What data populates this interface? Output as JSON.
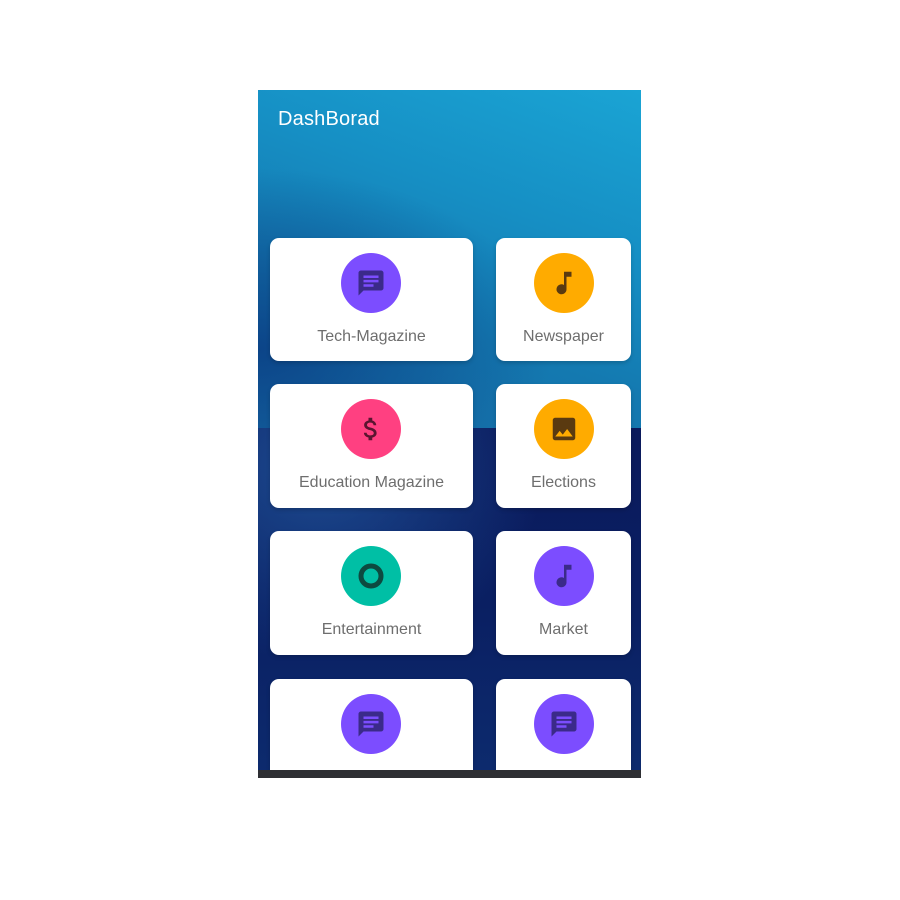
{
  "app": {
    "title": "DashBorad"
  },
  "colors": {
    "purple": "#7c4dff",
    "amber": "#ffab00",
    "pink": "#ff4081",
    "teal": "#00bfa5",
    "icon_dark": "#3b2a8a"
  },
  "tiles": [
    {
      "label": "Tech-Magazine",
      "icon": "chat-icon",
      "color": "#7c4dff"
    },
    {
      "label": "Newspaper",
      "icon": "music-note-icon",
      "color": "#ffab00"
    },
    {
      "label": "Education Magazine",
      "icon": "dollar-icon",
      "color": "#ff4081"
    },
    {
      "label": "Elections",
      "icon": "image-icon",
      "color": "#ffab00"
    },
    {
      "label": "Entertainment",
      "icon": "ring-icon",
      "color": "#00bfa5"
    },
    {
      "label": "Market",
      "icon": "music-note-icon",
      "color": "#7c4dff"
    },
    {
      "label": "",
      "icon": "chat-icon",
      "color": "#7c4dff"
    },
    {
      "label": "",
      "icon": "chat-icon",
      "color": "#7c4dff"
    }
  ]
}
